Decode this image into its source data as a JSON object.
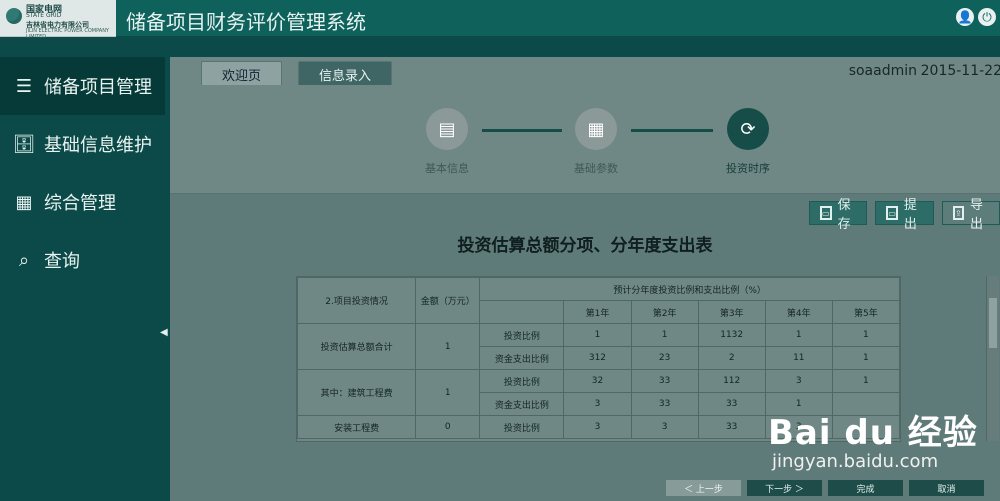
{
  "header": {
    "logo_line1": "国家电网",
    "logo_line2": "STATE GRID",
    "logo_line3": "吉林省电力有限公司",
    "logo_line4": "JILIN ELECTRIC POWER COMPANY LIMITED",
    "app_title": "储备项目财务评价管理系统"
  },
  "sidebar": {
    "items": [
      {
        "label": "储备项目管理",
        "icon": "list-icon",
        "active": true
      },
      {
        "label": "基础信息维护",
        "icon": "database-icon",
        "active": false
      },
      {
        "label": "综合管理",
        "icon": "grid-icon",
        "active": false
      },
      {
        "label": "查询",
        "icon": "search-icon",
        "active": false
      }
    ]
  },
  "tabs": [
    {
      "label": "欢迎页"
    },
    {
      "label": "信息录入"
    }
  ],
  "user": "soaadmin",
  "date": "2015-11-22",
  "steps": [
    {
      "label": "基本信息"
    },
    {
      "label": "基础参数"
    },
    {
      "label": "投资时序"
    }
  ],
  "actions": {
    "save": "保存",
    "submit": "提出",
    "export": "导出"
  },
  "document": {
    "title": "投资估算总额分项、分年度支出表"
  },
  "table": {
    "header_left": "2.项目投资情况",
    "header_amount": "金额（万元）",
    "header_group": "预计分年度投资比例和支出比例（%）",
    "years": [
      "第1年",
      "第2年",
      "第3年",
      "第4年",
      "第5年"
    ],
    "rows": [
      {
        "label": "投资估算总额合计",
        "amount": "1",
        "kind": "投资比例",
        "values": [
          "1",
          "1",
          "1132",
          "1",
          "1"
        ]
      },
      {
        "label": "",
        "amount": "",
        "kind": "资金支出比例",
        "values": [
          "312",
          "23",
          "2",
          "11",
          "1"
        ]
      },
      {
        "label": "其中：建筑工程费",
        "amount": "1",
        "kind": "投资比例",
        "values": [
          "32",
          "33",
          "112",
          "3",
          "1"
        ]
      },
      {
        "label": "",
        "amount": "",
        "kind": "资金支出比例",
        "values": [
          "3",
          "33",
          "33",
          "1",
          ""
        ]
      },
      {
        "label": "安装工程费",
        "amount": "0",
        "kind": "投资比例",
        "values": [
          "3",
          "3",
          "33",
          "3",
          ""
        ]
      }
    ]
  },
  "bottom_nav": {
    "prev": "＜ 上一步",
    "next": "下一步 ＞",
    "done": "完成",
    "cancel": "取消"
  },
  "watermark": {
    "line1": "Bai du 经验",
    "line2": "jingyan.baidu.com"
  },
  "colors": {
    "header_bg": "#0f615c",
    "sidebar_bg": "#0b4a48",
    "active_bg": "#063a39",
    "accent": "#174d48"
  }
}
